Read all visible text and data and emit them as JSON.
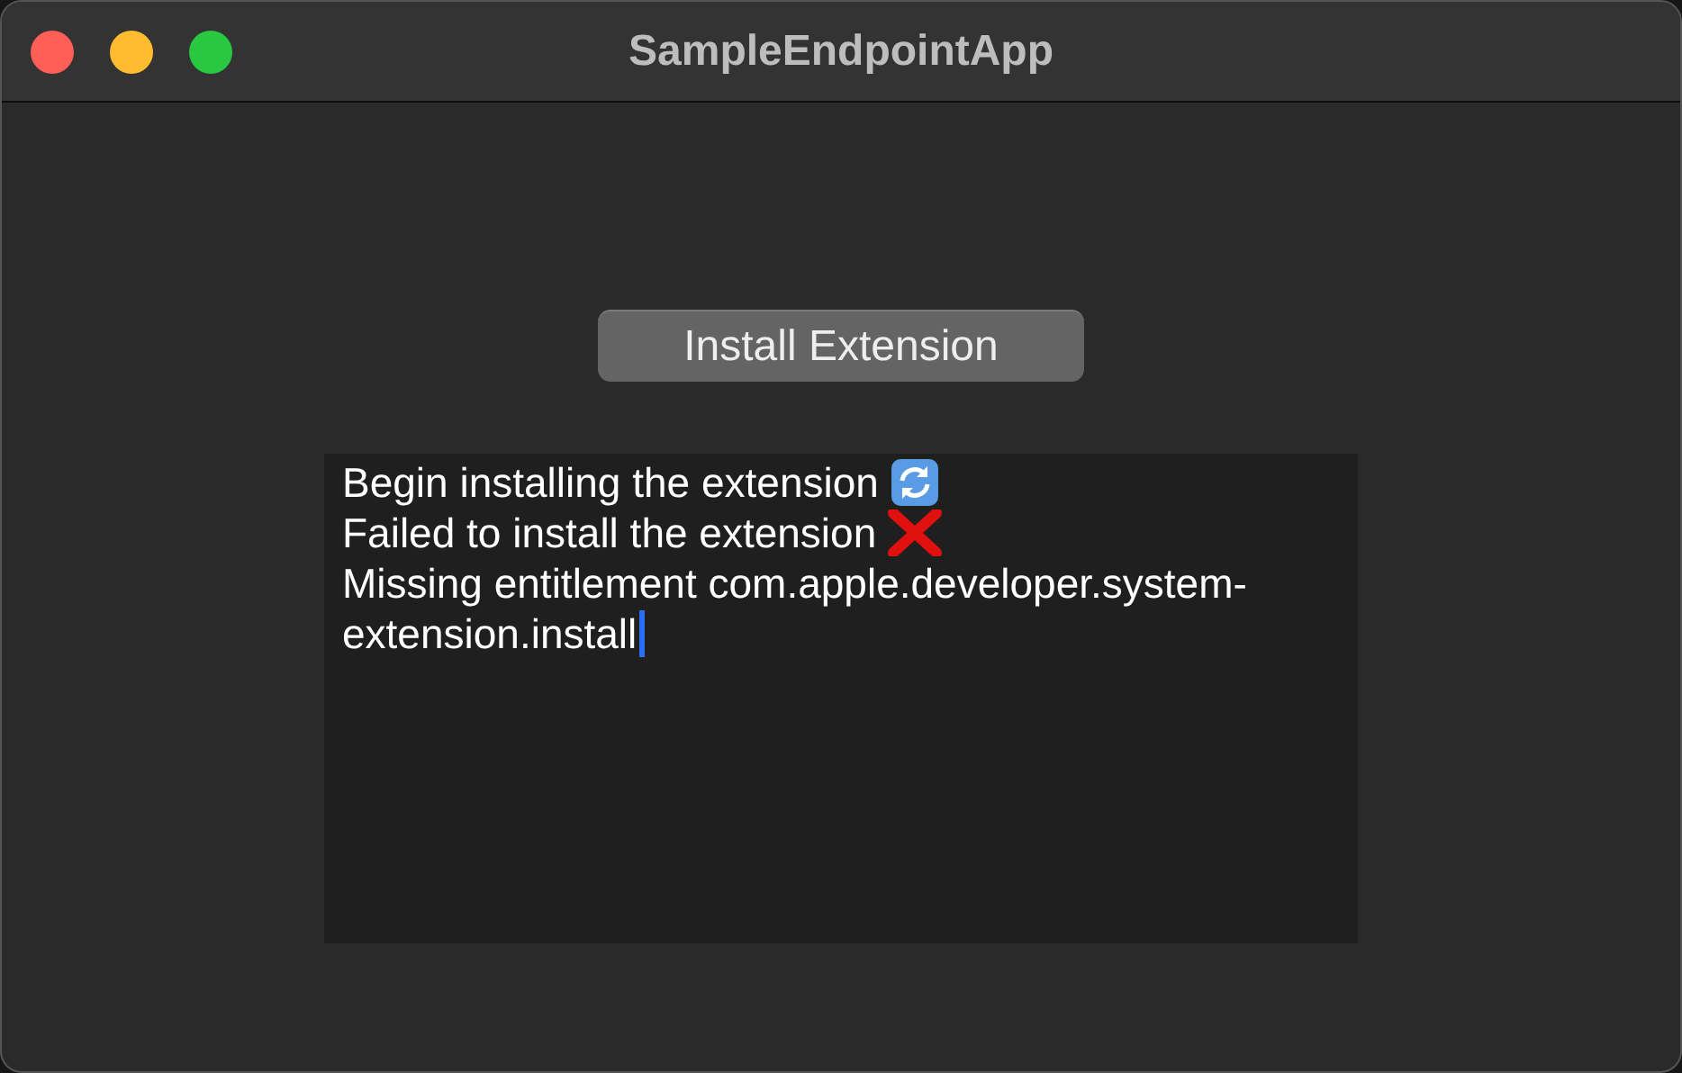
{
  "window": {
    "title": "SampleEndpointApp"
  },
  "button": {
    "label": "Install Extension"
  },
  "log": {
    "lines": [
      {
        "text": "Begin installing the extension",
        "kind": "progress"
      },
      {
        "text": "Failed to install the extension",
        "kind": "error"
      },
      {
        "text": "Missing entitlement com.apple.developer.system-extension.install",
        "kind": "info"
      }
    ],
    "caret": true
  }
}
